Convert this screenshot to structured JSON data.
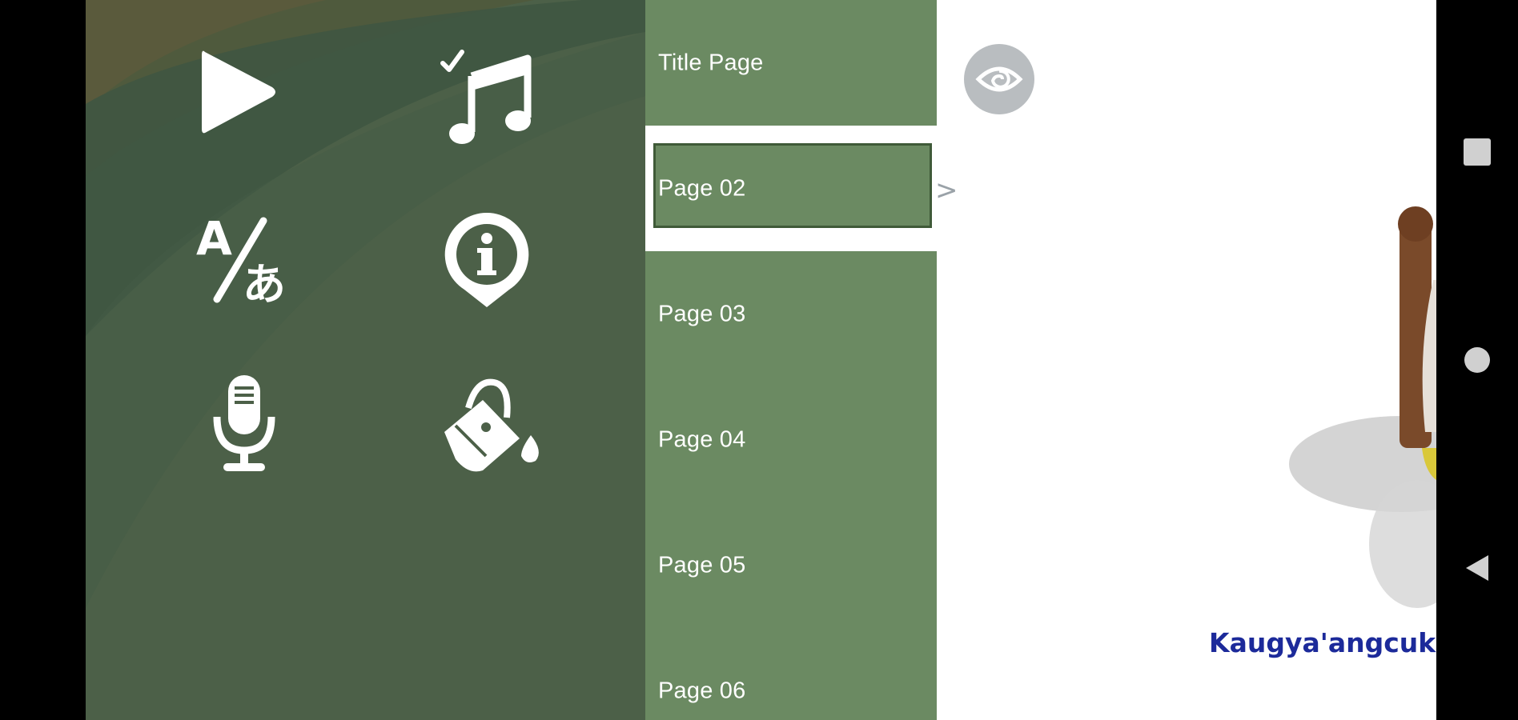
{
  "menu": {
    "icons": [
      {
        "name": "play-icon"
      },
      {
        "name": "music-check-icon"
      },
      {
        "name": "translate-icon"
      },
      {
        "name": "info-icon"
      },
      {
        "name": "microphone-icon"
      },
      {
        "name": "paint-bucket-icon"
      }
    ]
  },
  "pages": {
    "items": [
      {
        "label": "Title Page"
      },
      {
        "label": "Page 02"
      },
      {
        "label": "Page 03"
      },
      {
        "label": "Page 04"
      },
      {
        "label": "Page 05"
      },
      {
        "label": "Page 06"
      }
    ],
    "selected": "Page 02"
  },
  "book": {
    "chevron": ">",
    "eye_icon": "eye-icon",
    "caption": "Kaugya'angcuk es"
  },
  "nav": {
    "icons": [
      "recents-square-icon",
      "home-circle-icon",
      "back-triangle-icon"
    ]
  },
  "colors": {
    "menu_bg": "#4c6048",
    "page_list_bg": "#6b8a62",
    "caption": "#1c2a9a"
  }
}
